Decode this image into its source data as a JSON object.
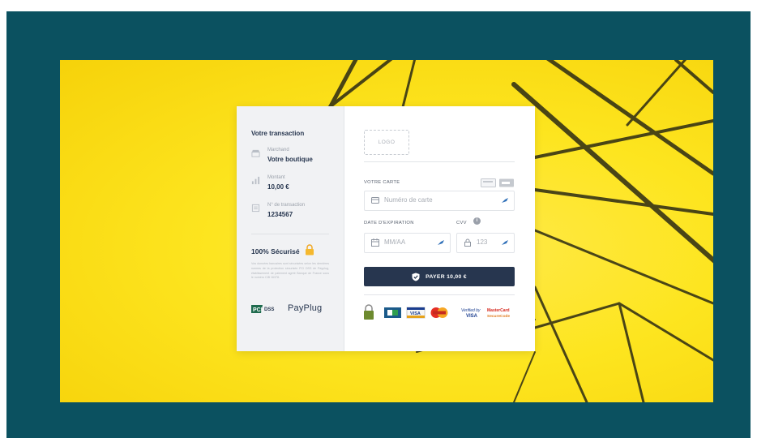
{
  "summary": {
    "title": "Votre transaction",
    "merchant_label": "Marchand",
    "merchant_value": "Votre boutique",
    "amount_label": "Montant",
    "amount_value": "10,00 €",
    "transaction_label": "N° de transaction",
    "transaction_value": "1234567"
  },
  "security": {
    "title": "100% Sécurisé",
    "fine_print": "Vos données bancaires sont sécurisées selon les dernières normes de la protection sécurisée PCI DSS de Payplug, établissement de paiement agréé Banque de France sous le numéro CIB 16378.",
    "payplug_label": "PayPlug"
  },
  "form": {
    "logo_placeholder": "LOGO",
    "card_label": "VOTRE CARTE",
    "card_placeholder": "Numéro de carte",
    "expiry_label": "DATE D'EXPIRATION",
    "expiry_placeholder": "MM/AA",
    "cvv_label": "CVV",
    "cvv_placeholder": "123",
    "pay_button": "PAYER 10,00 €"
  },
  "icons": [
    "store-icon",
    "chart-icon",
    "receipt-icon",
    "lock-icon",
    "pci-dss-logo",
    "card-icon",
    "calendar-icon",
    "lock-icon",
    "autofill-icon",
    "shield-check-icon",
    "cb-logo",
    "visa-logo",
    "mastercard-logo",
    "verified-by-visa-logo",
    "mastercard-securecode-logo"
  ],
  "colors": {
    "frame": "#0b5160",
    "background_photo": "#fde51f",
    "navy": "#27364f",
    "accent_icon": "#2f6fb8"
  }
}
